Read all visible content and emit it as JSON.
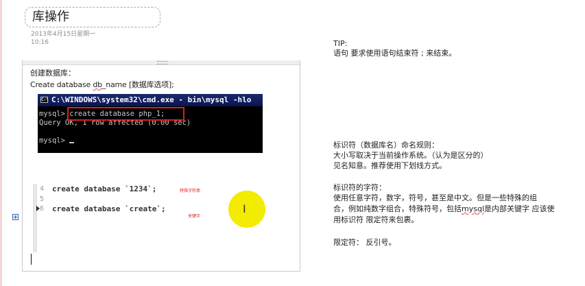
{
  "page": {
    "title": "库操作",
    "date": "2013年4月15日星期一",
    "time": "10:16"
  },
  "content": {
    "heading": "创建数据库：",
    "syntax_prefix": "Create database ",
    "syntax_squiggle": "db",
    "syntax_suffix": "_name [数据库选项];"
  },
  "cmd": {
    "title": "C:\\WINDOWS\\system32\\cmd.exe - bin\\mysql -hlo",
    "icon_label": "C:\\",
    "prompt1": "mysql>",
    "command1": " create database php_1;",
    "output": "Query OK, 1 row affected (0.00 sec)",
    "prompt2": "mysql>"
  },
  "code": {
    "lines": [
      {
        "num": "4",
        "text": "create database `1234`;"
      },
      {
        "num": "5",
        "text": ""
      },
      {
        "num": "6",
        "text": "create database `create`;"
      }
    ],
    "note1": "特殊字符串",
    "note2": "关键字"
  },
  "tips": {
    "tip_label": "TIP:",
    "tip_text": "语句 要求使用语句结束符 ; 来结束。",
    "rules_title": "标识符（数据库名）命名规则：",
    "rule1": "大小写取决于当前操作系统。（认为是区分的）",
    "rule2": "见名知意。推荐使用下划线方式。",
    "chars_title": "标识符的字符：",
    "chars1": "使用任意字符，数字，符号，甚至是中文。但是一些特殊的组",
    "chars2_prefix": "合，例如纯数字组合，特殊符号，包括",
    "chars2_squiggle": "mysql",
    "chars2_suffix": "是内部关键字 应该使",
    "chars3": "用标识符 限定符来包裹。",
    "delim": "限定符： 反引号。"
  },
  "colors": {
    "accent_red": "#e02020",
    "highlight_yellow": "#f3eb00",
    "cmd_titlebar": "#0a1450"
  }
}
